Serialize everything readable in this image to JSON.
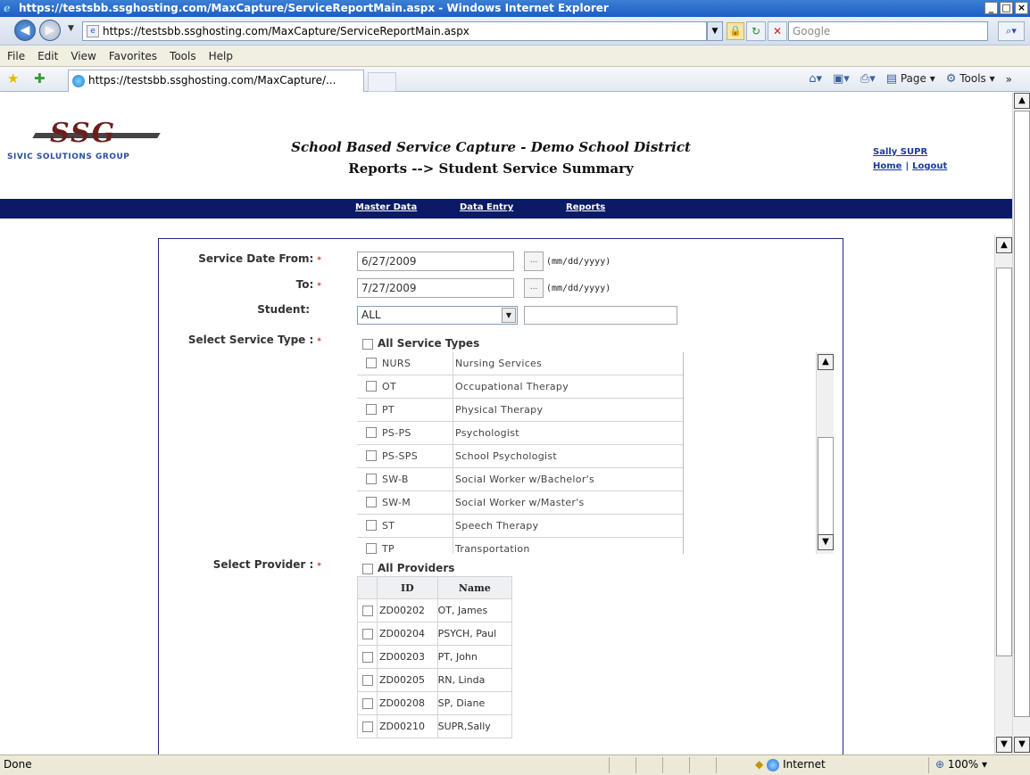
{
  "window": {
    "title": "https://testsbb.ssghosting.com/MaxCapture/ServiceReportMain.aspx - Windows Internet Explorer",
    "buttons": {
      "minimize": "_",
      "maximize": "□",
      "close": "×"
    }
  },
  "addressbar": {
    "url": "https://testsbb.ssghosting.com/MaxCapture/ServiceReportMain.aspx",
    "search_placeholder": "Google"
  },
  "menu": [
    "File",
    "Edit",
    "View",
    "Favorites",
    "Tools",
    "Help"
  ],
  "tab": {
    "label": "https://testsbb.ssghosting.com/MaxCapture/..."
  },
  "commands": {
    "page": "Page",
    "tools": "Tools"
  },
  "header": {
    "brand": "SSG",
    "company": "SIVIC SOLUTIONS GROUP",
    "title": "School Based Service Capture - Demo School District",
    "subtitle": "Reports --> Student Service Summary",
    "user": "Sally SUPR",
    "home": "Home",
    "sep": "|",
    "logout": "Logout"
  },
  "nav": [
    "Master Data",
    "Data Entry",
    "Reports"
  ],
  "form": {
    "date_from_label": "Service Date From:",
    "date_from": "6/27/2009",
    "date_to_label": "To:",
    "date_to": "7/27/2009",
    "date_hint": "(mm/dd/yyyy)",
    "cal_btn": "...",
    "student_label": "Student:",
    "student_value": "ALL",
    "service_type_label": "Select Service Type :",
    "all_service_types": "All Service Types",
    "provider_label": "Select Provider :",
    "all_providers": "All Providers",
    "required_mark": "*"
  },
  "services": [
    {
      "code": "NURS",
      "name": "Nursing Services"
    },
    {
      "code": "OT",
      "name": "Occupational Therapy"
    },
    {
      "code": "PT",
      "name": "Physical Therapy"
    },
    {
      "code": "PS-PS",
      "name": "Psychologist"
    },
    {
      "code": "PS-SPS",
      "name": "School Psychologist"
    },
    {
      "code": "SW-B",
      "name": "Social Worker w/Bachelor's"
    },
    {
      "code": "SW-M",
      "name": "Social Worker w/Master's"
    },
    {
      "code": "ST",
      "name": "Speech Therapy"
    },
    {
      "code": "TP",
      "name": "Transportation"
    }
  ],
  "providers": {
    "headers": [
      "ID",
      "Name"
    ],
    "rows": [
      {
        "id": "ZD00202",
        "name": "OT, James"
      },
      {
        "id": "ZD00204",
        "name": "PSYCH, Paul"
      },
      {
        "id": "ZD00203",
        "name": "PT, John"
      },
      {
        "id": "ZD00205",
        "name": "RN, Linda"
      },
      {
        "id": "ZD00208",
        "name": "SP, Diane"
      },
      {
        "id": "ZD00210",
        "name": "SUPR,Sally"
      }
    ]
  },
  "status": {
    "text": "Done",
    "zone": "Internet",
    "zoom": "100%"
  }
}
